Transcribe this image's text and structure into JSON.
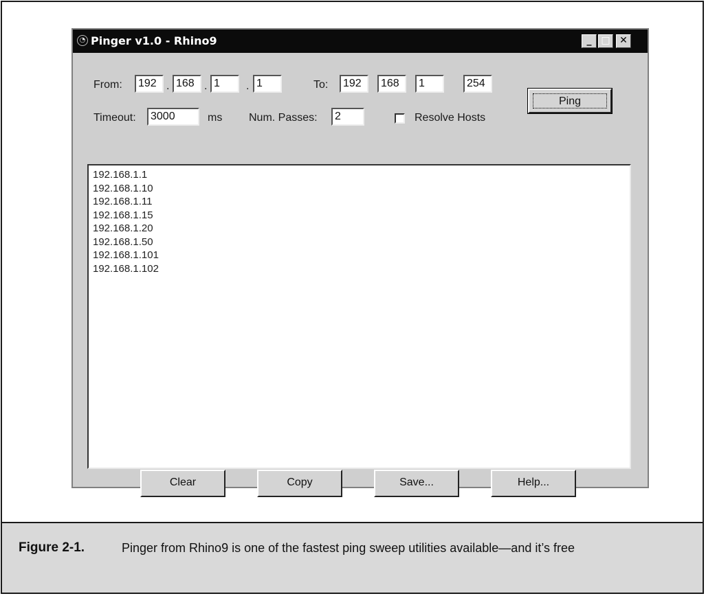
{
  "window": {
    "title": "Pinger v1.0 - Rhino9",
    "icon": "pinger-app-icon",
    "controls": {
      "minimize": "_",
      "maximize": "□",
      "close": "✕"
    }
  },
  "form": {
    "from_label": "From:",
    "from_octets": [
      "192",
      "168",
      "1",
      "1"
    ],
    "to_label": "To:",
    "to_octets": [
      "192",
      "168",
      "1",
      "254"
    ],
    "octet_separator": ".",
    "timeout_label": "Timeout:",
    "timeout_value": "3000",
    "timeout_unit": "ms",
    "passes_label": "Num. Passes:",
    "passes_value": "2",
    "resolve_label": "Resolve Hosts",
    "resolve_checked": false
  },
  "ping_button": "Ping",
  "results": [
    "192.168.1.1",
    "192.168.1.10",
    "192.168.1.11",
    "192.168.1.15",
    "192.168.1.20",
    "192.168.1.50",
    "192.168.1.101",
    "192.168.1.102"
  ],
  "buttons": {
    "clear": "Clear",
    "copy": "Copy",
    "save": "Save...",
    "help": "Help..."
  },
  "caption": {
    "label": "Figure 2-1.",
    "text": "Pinger from Rhino9 is one of the fastest ping sweep utilities available—and it’s free"
  }
}
